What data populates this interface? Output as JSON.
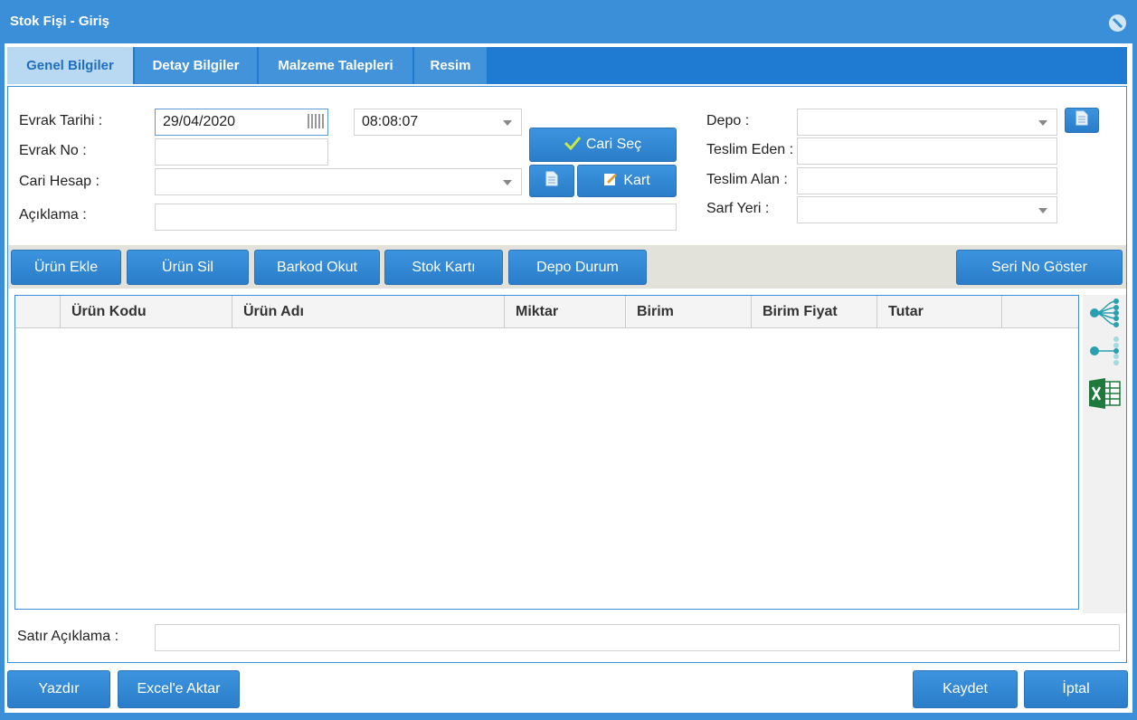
{
  "window": {
    "title": "Stok Fişi - Giriş"
  },
  "tabs": [
    {
      "label": "Genel Bilgiler",
      "active": true
    },
    {
      "label": "Detay Bilgiler",
      "active": false
    },
    {
      "label": "Malzeme Talepleri",
      "active": false
    },
    {
      "label": "Resim",
      "active": false
    }
  ],
  "form": {
    "evrak_tarihi_label": "Evrak Tarihi :",
    "evrak_tarihi_value": "29/04/2020",
    "saat_value": "08:08:07",
    "evrak_no_label": "Evrak No :",
    "evrak_no_value": "",
    "cari_hesap_label": "Cari Hesap :",
    "cari_hesap_value": "",
    "aciklama_label": "Açıklama :",
    "aciklama_value": "",
    "cari_sec_label": "Cari Seç",
    "kart_label": "Kart",
    "depo_label": "Depo :",
    "depo_value": "",
    "teslim_eden_label": "Teslim Eden :",
    "teslim_eden_value": "",
    "teslim_alan_label": "Teslim Alan :",
    "teslim_alan_value": "",
    "sarf_yeri_label": "Sarf Yeri :",
    "sarf_yeri_value": ""
  },
  "toolbar": {
    "urun_ekle": "Ürün Ekle",
    "urun_sil": "Ürün Sil",
    "barkod_okut": "Barkod Okut",
    "stok_karti": "Stok Kartı",
    "depo_durum": "Depo Durum",
    "seri_no_goster": "Seri No Göster"
  },
  "grid": {
    "columns": [
      "",
      "Ürün Kodu",
      "Ürün Adı",
      "Miktar",
      "Birim",
      "Birim Fiyat",
      "Tutar",
      ""
    ],
    "rows": []
  },
  "sidebar_icons": [
    "expand-all-icon",
    "collapse-all-icon",
    "excel-icon"
  ],
  "bottom": {
    "satir_aciklama_label": "Satır Açıklama :",
    "satir_aciklama_value": ""
  },
  "footer": {
    "yazdir": "Yazdır",
    "excel_aktar": "Excel'e Aktar",
    "kaydet": "Kaydet",
    "iptal": "İptal"
  },
  "colors": {
    "accent": "#3a8fd8",
    "tab_bar": "#1f7bd2",
    "active_tab": "#b9d9f2",
    "toolbar_bg": "#e2e2da"
  }
}
